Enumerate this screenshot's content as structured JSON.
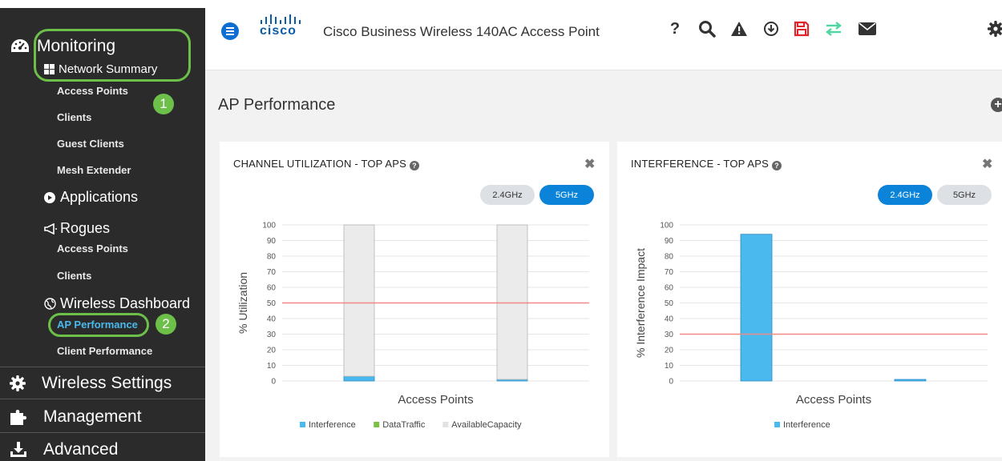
{
  "sidebar": {
    "monitoring": "Monitoring",
    "network_summary": "Network Summary",
    "network_items": [
      "Access Points",
      "Clients",
      "Guest Clients",
      "Mesh Extender"
    ],
    "applications": "Applications",
    "rogues": "Rogues",
    "rogue_items": [
      "Access Points",
      "Clients"
    ],
    "wireless_dashboard": "Wireless Dashboard",
    "ap_performance": "AP Performance",
    "client_performance": "Client Performance",
    "wireless_settings": "Wireless Settings",
    "management": "Management",
    "advanced": "Advanced",
    "badges": [
      "1",
      "2"
    ]
  },
  "header": {
    "logo_text": "cisco",
    "title": "Cisco Business Wireless 140AC Access Point",
    "icons": [
      "help-icon",
      "search-icon",
      "alert-icon",
      "download-icon",
      "save-icon",
      "transfer-icon",
      "mail-icon",
      "gear-icon"
    ],
    "colors": {
      "menu": "#0d6fd1",
      "save": "#e0262c",
      "transfer": "#4fd6a0"
    }
  },
  "page": {
    "title": "AP Performance"
  },
  "panels": [
    {
      "title": "CHANNEL UTILIZATION - TOP APS",
      "toggles": [
        "2.4GHz",
        "5GHz"
      ],
      "active_toggle": "5GHz"
    },
    {
      "title": "INTERFERENCE - TOP APS",
      "toggles": [
        "2.4GHz",
        "5GHz"
      ],
      "active_toggle": "2.4GHz"
    }
  ],
  "chart_data": [
    {
      "type": "bar",
      "stacked": true,
      "xlabel": "Access Points",
      "ylabel": "% Utilization",
      "ylim": [
        0,
        100
      ],
      "yticks": [
        0,
        10,
        20,
        30,
        40,
        50,
        60,
        70,
        80,
        90,
        100
      ],
      "threshold": 50,
      "series": [
        {
          "name": "Interference",
          "color": "#4ab9ee",
          "values": [
            3,
            1
          ]
        },
        {
          "name": "DataTraffic",
          "color": "#7ac143",
          "values": [
            0,
            0
          ]
        },
        {
          "name": "AvailableCapacity",
          "color": "#ebebeb",
          "values": [
            97,
            99
          ]
        }
      ]
    },
    {
      "type": "bar",
      "xlabel": "Access Points",
      "ylabel": "% Interference Impact",
      "ylim": [
        0,
        100
      ],
      "yticks": [
        0,
        10,
        20,
        30,
        40,
        50,
        60,
        70,
        80,
        90,
        100
      ],
      "threshold": 30,
      "series": [
        {
          "name": "Interference",
          "color": "#4ab9ee",
          "values": [
            94,
            1
          ]
        }
      ]
    }
  ]
}
